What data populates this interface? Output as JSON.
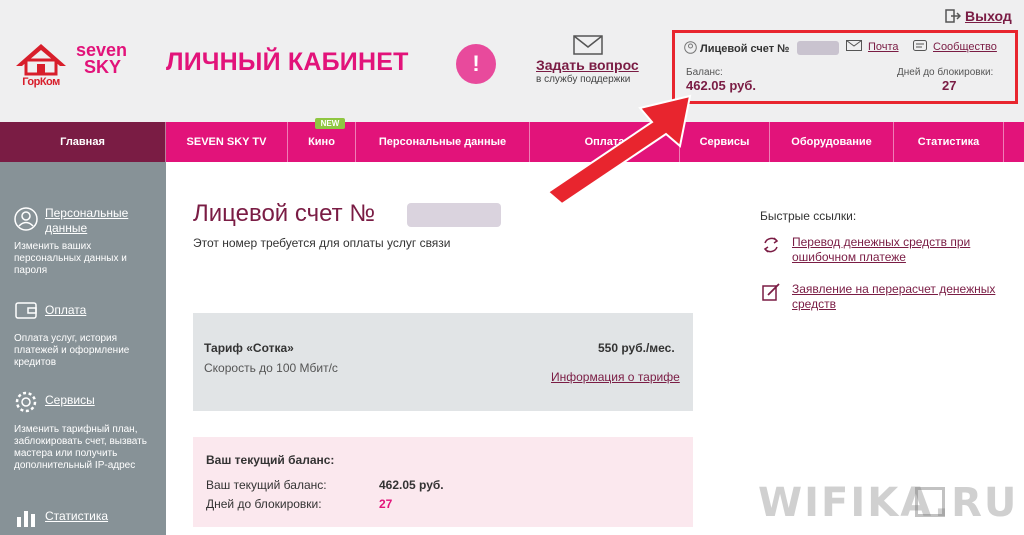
{
  "header": {
    "logo_gorkom": "ГорКом",
    "logo_seven_line1": "seven",
    "logo_seven_line2": "SKY",
    "page_heading": "ЛИЧНЫЙ КАБИНЕТ",
    "alert_symbol": "!",
    "ask_question": "Задать вопрос",
    "ask_question_sub": "в службу поддержки",
    "exit_label": "Выход"
  },
  "account_box": {
    "account_label": "Лицевой счет №",
    "mail_label": "Почта",
    "community_label": "Сообщество",
    "balance_label": "Баланс:",
    "balance_value": "462.05 руб.",
    "days_label": "Дней до блокировки:",
    "days_value": "27"
  },
  "nav": {
    "items": [
      {
        "label": "Главная"
      },
      {
        "label": "SEVEN SKY TV"
      },
      {
        "label": "Кино"
      },
      {
        "label": "Персональные данные"
      },
      {
        "label": "Оплата"
      },
      {
        "label": "Сервисы"
      },
      {
        "label": "Оборудование"
      },
      {
        "label": "Статистика"
      }
    ],
    "new_badge": "NEW"
  },
  "sidebar": {
    "items": [
      {
        "title": "Персональные данные",
        "desc": "Изменить ваших персональных данных и пароля",
        "icon": "user-icon"
      },
      {
        "title": "Оплата",
        "desc": "Оплата услуг, история платежей и оформление кредитов",
        "icon": "wallet-icon"
      },
      {
        "title": "Сервисы",
        "desc": "Изменить тарифный план, заблокировать счет, вызвать мастера или получить дополнительный IP-адрес",
        "icon": "gear-icon"
      },
      {
        "title": "Статистика",
        "icon": "chart-icon"
      }
    ]
  },
  "main": {
    "title": "Лицевой счет №",
    "subtitle": "Этот номер требуется для оплаты услуг связи",
    "tariff": {
      "name": "Тариф «Сотка»",
      "price": "550 руб./мес.",
      "speed": "Скорость до 100 Мбит/с",
      "info_link": "Информация о тарифе"
    },
    "balance": {
      "heading": "Ваш текущий баланс:",
      "label1": "Ваш текущий баланс:",
      "value1": "462.05 руб.",
      "label2": "Дней до блокировки:",
      "value2": "27"
    }
  },
  "quick_links": {
    "heading": "Быстрые ссылки:",
    "items": [
      {
        "label": "Перевод денежных средств при ошибочном платеже",
        "icon": "refresh-icon"
      },
      {
        "label": "Заявление на перерасчет денежных средств",
        "icon": "edit-icon"
      }
    ]
  },
  "watermark": "WIFIKA.RU",
  "colors": {
    "brand_pink": "#e2137a",
    "brand_dark": "#7a1c44",
    "sidebar_gray": "#879297",
    "highlight_red": "#e8252e"
  }
}
